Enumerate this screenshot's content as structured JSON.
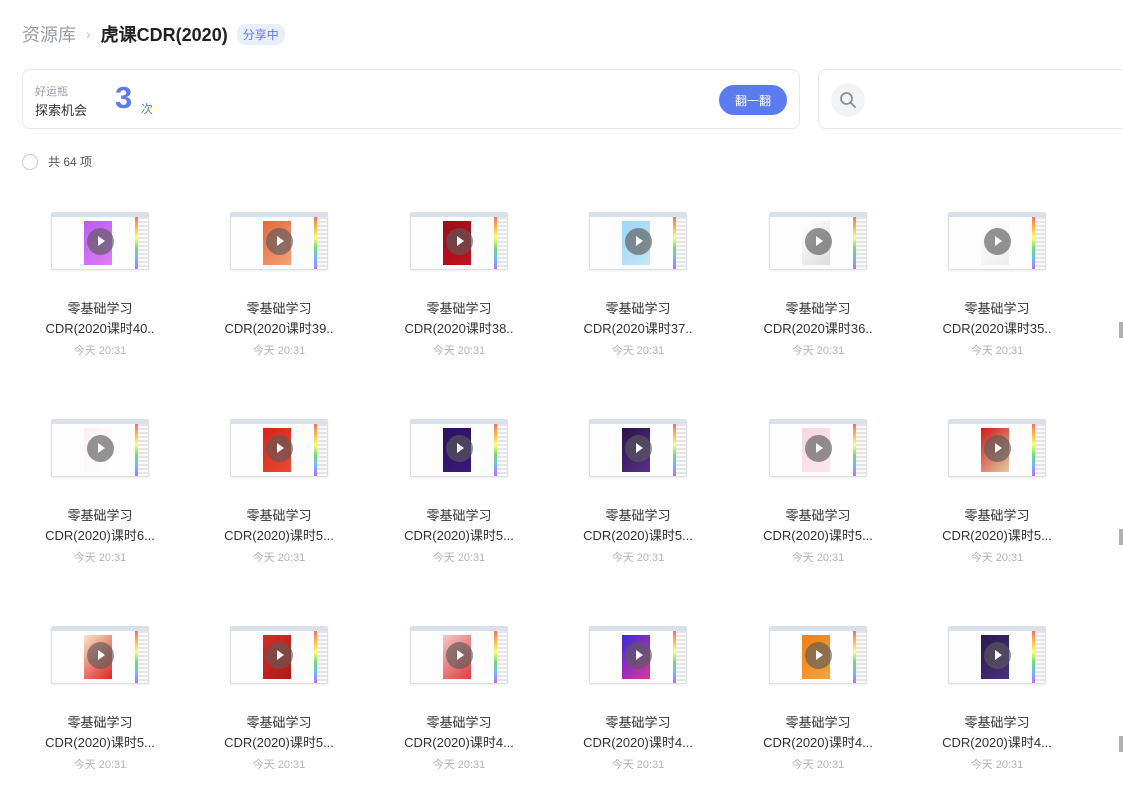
{
  "breadcrumb": {
    "root": "资源库",
    "separator": "›",
    "current": "虎课CDR(2020)",
    "badge": "分享中"
  },
  "lucky": {
    "title": "好运瓶",
    "subtitle": "探索机会",
    "count": "3",
    "unit": "次",
    "button": "翻一翻"
  },
  "search": {
    "placeholder": ""
  },
  "list": {
    "total": "共 64 项"
  },
  "items": [
    {
      "line1": "零基础学习",
      "line2": "CDR(2020课时40..",
      "time": "今天 20:31",
      "art": "#b95cf5",
      "artb": "#e07cf2"
    },
    {
      "line1": "零基础学习",
      "line2": "CDR(2020课时39..",
      "time": "今天 20:31",
      "art": "#e8663a",
      "artb": "#f3a37a"
    },
    {
      "line1": "零基础学习",
      "line2": "CDR(2020课时38..",
      "time": "今天 20:31",
      "art": "#9b0e16",
      "artb": "#c1121e"
    },
    {
      "line1": "零基础学习",
      "line2": "CDR(2020课时37..",
      "time": "今天 20:31",
      "art": "#9dd6f5",
      "artb": "#c4e6f9"
    },
    {
      "line1": "零基础学习",
      "line2": "CDR(2020课时36..",
      "time": "今天 20:31",
      "art": "#ffffff",
      "artb": "#dddddd"
    },
    {
      "line1": "零基础学习",
      "line2": "CDR(2020课时35..",
      "time": "今天 20:31",
      "art": "#ffffff",
      "artb": "#eeeeee"
    },
    {
      "line1": "零基础学习",
      "line2": "CDR(2020)课时6...",
      "time": "今天 20:31",
      "art": "#fbeff2",
      "artb": "#ffffff"
    },
    {
      "line1": "零基础学习",
      "line2": "CDR(2020)课时5...",
      "time": "今天 20:31",
      "art": "#d8221d",
      "artb": "#e94a2e"
    },
    {
      "line1": "零基础学习",
      "line2": "CDR(2020)课时5...",
      "time": "今天 20:31",
      "art": "#2b1160",
      "artb": "#3b1a7a"
    },
    {
      "line1": "零基础学习",
      "line2": "CDR(2020)课时5...",
      "time": "今天 20:31",
      "art": "#2a1449",
      "artb": "#5a2f8a"
    },
    {
      "line1": "零基础学习",
      "line2": "CDR(2020)课时5...",
      "time": "今天 20:31",
      "art": "#f7d6e2",
      "artb": "#fbe7ee"
    },
    {
      "line1": "零基础学习",
      "line2": "CDR(2020)课时5...",
      "time": "今天 20:31",
      "art": "#cf1b17",
      "artb": "#e3c9a4"
    },
    {
      "line1": "零基础学习",
      "line2": "CDR(2020)课时5...",
      "time": "今天 20:31",
      "art": "#fbe3c7",
      "artb": "#e02424"
    },
    {
      "line1": "零基础学习",
      "line2": "CDR(2020)课时5...",
      "time": "今天 20:31",
      "art": "#d62b24",
      "artb": "#b31a17"
    },
    {
      "line1": "零基础学习",
      "line2": "CDR(2020)课时4...",
      "time": "今天 20:31",
      "art": "#f4c7c7",
      "artb": "#e23c3c"
    },
    {
      "line1": "零基础学习",
      "line2": "CDR(2020)课时4...",
      "time": "今天 20:31",
      "art": "#3b2bd8",
      "artb": "#e0349a"
    },
    {
      "line1": "零基础学习",
      "line2": "CDR(2020)课时4...",
      "time": "今天 20:31",
      "art": "#f07f14",
      "artb": "#f6a23c"
    },
    {
      "line1": "零基础学习",
      "line2": "CDR(2020)课时4...",
      "time": "今天 20:31",
      "art": "#2a1a4f",
      "artb": "#4a2e7c"
    }
  ]
}
